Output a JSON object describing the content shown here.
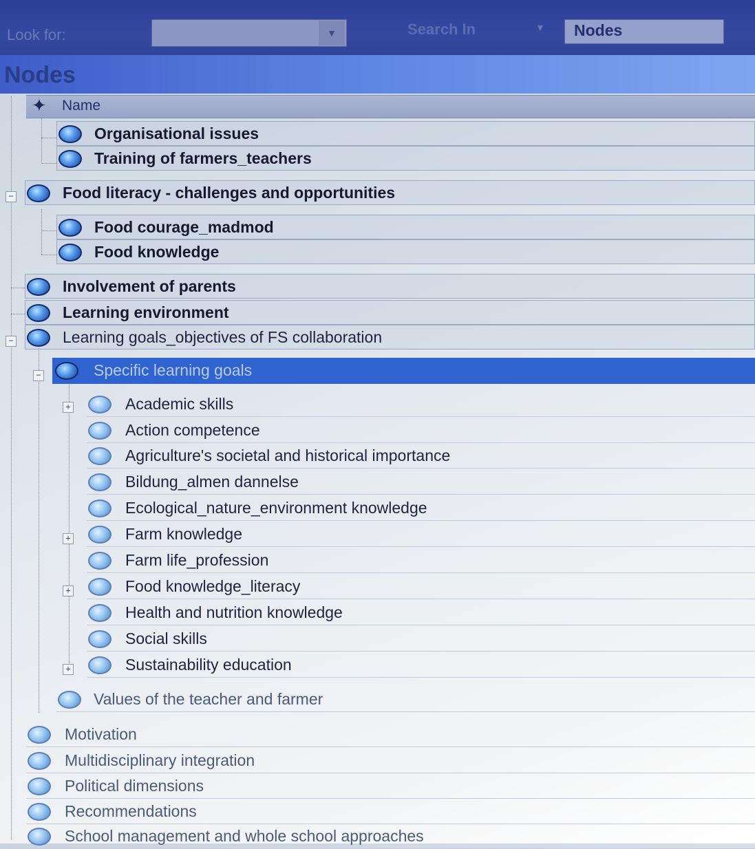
{
  "search": {
    "look_for_label": "Look for:",
    "look_for_value": "",
    "search_in_label": "Search In",
    "scope_value": "Nodes"
  },
  "panel": {
    "title": "Nodes",
    "column_name": "Name"
  },
  "colors": {
    "selection": "#2f63cf",
    "toolbar": "#2b3f9a",
    "node_icon": "#4d94e6"
  },
  "tree": {
    "r1": "Organisational issues",
    "r2": "Training of farmers_teachers",
    "r3": "Food literacy - challenges and opportunities",
    "r4": "Food courage_madmod",
    "r5": "Food knowledge",
    "r6": "Involvement of parents",
    "r7": "Learning environment",
    "r8": "Learning goals_objectives of FS collaboration",
    "r9": "Specific learning goals",
    "r10": "Academic skills",
    "r11": "Action competence",
    "r12": "Agriculture's societal and historical importance",
    "r13": "Bildung_almen dannelse",
    "r14": "Ecological_nature_environment knowledge",
    "r15": "Farm knowledge",
    "r16": "Farm life_profession",
    "r17": "Food knowledge_literacy",
    "r18": "Health and nutrition knowledge",
    "r19": "Social skills",
    "r20": "Sustainability education",
    "r21": "Values of the teacher and farmer",
    "r22": "Motivation",
    "r23": "Multidisciplinary integration",
    "r24": "Political dimensions",
    "r25": "Recommendations",
    "r26": "School management and whole school approaches"
  }
}
